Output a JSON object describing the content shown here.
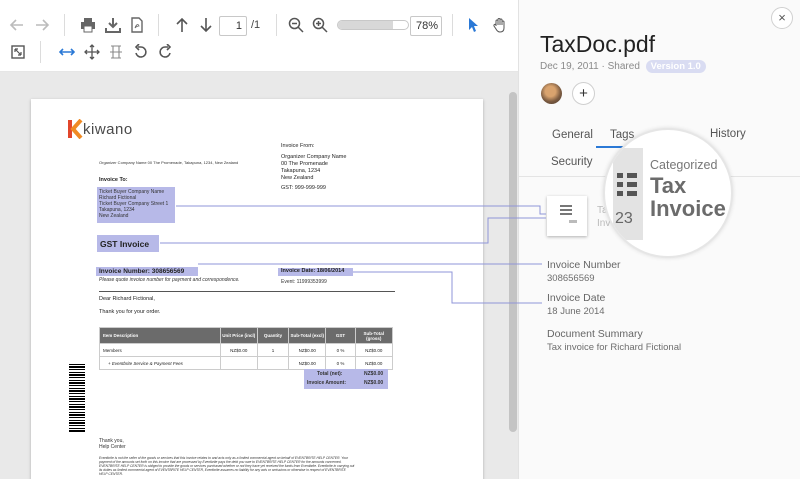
{
  "toolbar": {
    "page_current": "1",
    "page_total": "/1",
    "zoom_value": "78%",
    "zoom_level": 0.78
  },
  "document": {
    "logo_text": "kiwano",
    "org_address_line": "Organizer Company Name 00 The Promenade, Takapuna, 1234, New Zealand",
    "invoice_from_label": "Invoice From:",
    "invoice_from_lines": [
      "Organizer Company Name",
      "00 The Promenade",
      "Takapuna, 1234",
      "New Zealand"
    ],
    "gst_line": "GST: 999-999-999",
    "invoice_to_label": "Invoice To:",
    "invoice_to_lines": [
      "Ticket Buyer Company Name",
      "Richard Fictional",
      "Ticket Buyer Company Street 1",
      "Takapuna, 1234",
      "New Zealand"
    ],
    "gst_invoice": "GST Invoice",
    "invoice_number": "Invoice Number: 308656569",
    "quote_note": "Please quote invoice number for payment and correspondence.",
    "invoice_date": "Invoice Date: 18/06/2014",
    "event_line": "Event: 11999353999",
    "greeting": "Dear Richard Fictional,",
    "thanks": "Thank you for your order.",
    "table_headers": [
      "Item Description",
      "Unit Price (incl)",
      "Quantity",
      "Sub-Total (excl)",
      "GST",
      "Sub-Total (gross)"
    ],
    "table_rows": [
      [
        "Members",
        "NZ$0.00",
        "1",
        "NZ$0.00",
        "0 %",
        "NZ$0.00"
      ],
      [
        "+ Eventbrite Service & Payment Fees",
        "",
        "",
        "NZ$0.00",
        "0 %",
        "NZ$0.00"
      ]
    ],
    "total_label": "Total (net):",
    "total_value": "NZ$0.00",
    "invoice_amount_label": "Invoice Amount:",
    "invoice_amount_value": "NZ$0.00",
    "signoff": "Thank you,",
    "signoff_team": "Help Center",
    "footer_lines": [
      "Eventbrite is not the seller of the goods or services that this invoice relates to and acts only as a limited commercial agent on behalf of EVENTBRITE HELP CENTER. Your",
      "payment of the amounts set forth on this invoice that are processed by Eventbrite pays the debt you owe to EVENTBRITE HELP CENTER for the amounts concerned.",
      "EVENTBRITE HELP CENTER is obliged to provide the goods or services purchased whether or not they have yet received the funds from Eventbrite. Eventbrite in carrying out",
      "its duties as limited commercial agent of EVENTBRITE HELP CENTER, Eventbrite assumes no liability for any acts or omissions or otherwise in respect of EVENTBRITE",
      "HELP CENTER."
    ]
  },
  "panel": {
    "close": "×",
    "title": "TaxDoc.pdf",
    "meta": "Dec 19, 2011 · Shared",
    "version": "Version 1.0",
    "add": "+",
    "tabs": [
      "General",
      "Tags",
      "History",
      "Security"
    ],
    "active_tab": "Tags",
    "tag_partial_1": "Tag",
    "tag_partial_2": "Inv",
    "magnifier": {
      "category": "Categorized",
      "title_line1": "Tax",
      "title_line2": "Invoice",
      "number": "23"
    },
    "fields": [
      {
        "label": "Invoice Number",
        "value": "308656569"
      },
      {
        "label": "Invoice Date",
        "value": "18 June 2014"
      },
      {
        "label": "Document Summary",
        "value": "Tax invoice for Richard Fictional"
      }
    ]
  },
  "colors": {
    "accent": "#2b79d6",
    "highlight": "#b7b9e8",
    "connector": "#8f95d8",
    "version_badge": "#d9dcf2"
  }
}
